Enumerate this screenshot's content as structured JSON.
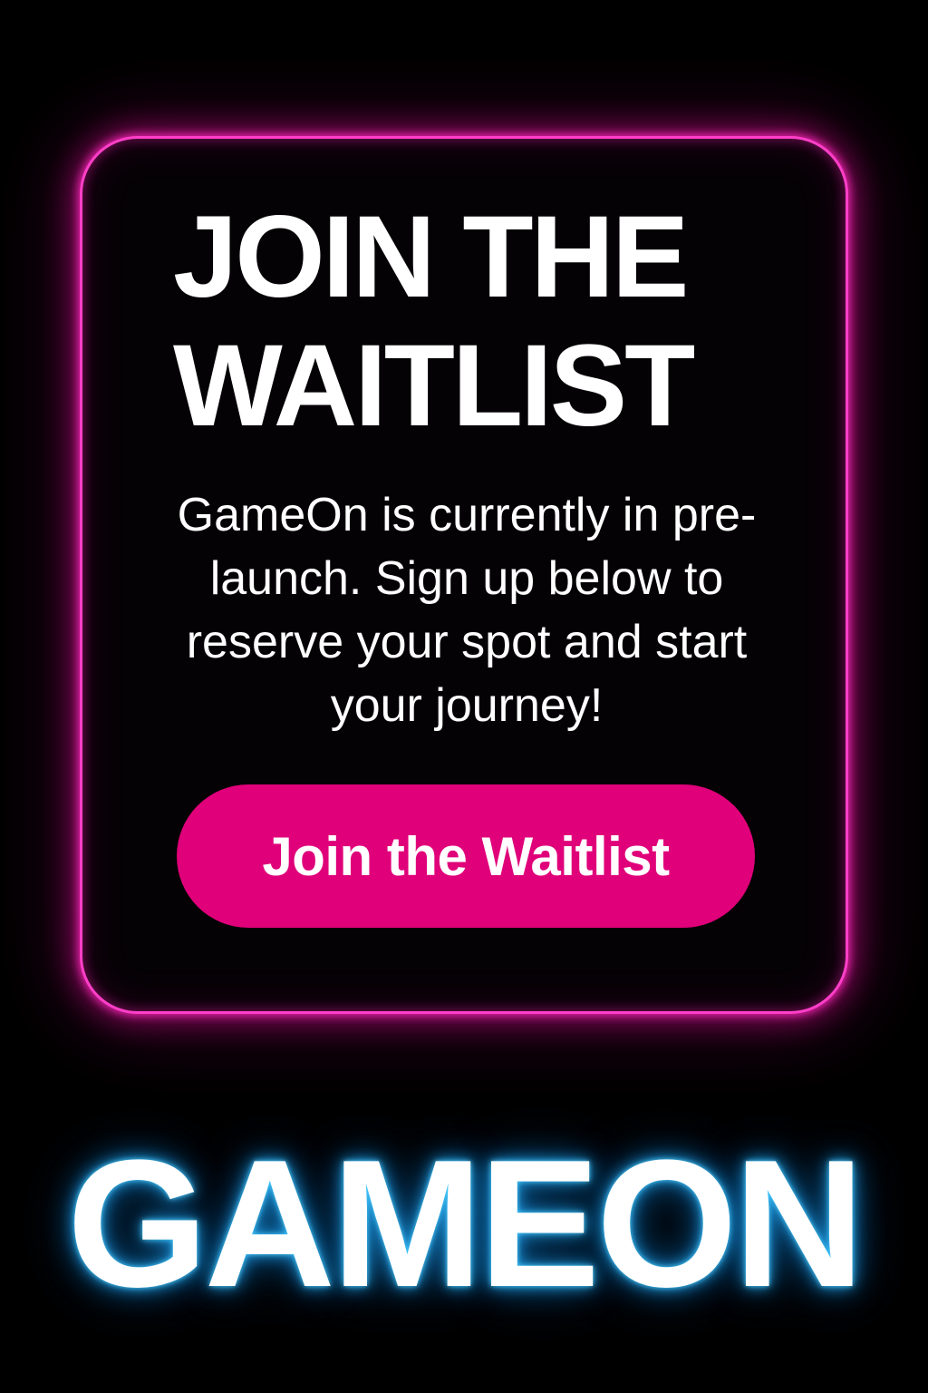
{
  "waitlist_card": {
    "headline_line1": "JOIN THE",
    "headline_line2": "WAITLIST",
    "description": "GameOn is currently in pre-launch. Sign up below to reserve your spot and start your journey!",
    "button_label": "Join the Waitlist"
  },
  "brand": {
    "logo_text": "GAMEON"
  },
  "colors": {
    "background": "#000000",
    "card_border_glow": "#ff3fc8",
    "button_fill": "#e0007a",
    "text": "#ffffff",
    "logo_glow": "#28b4ff"
  }
}
